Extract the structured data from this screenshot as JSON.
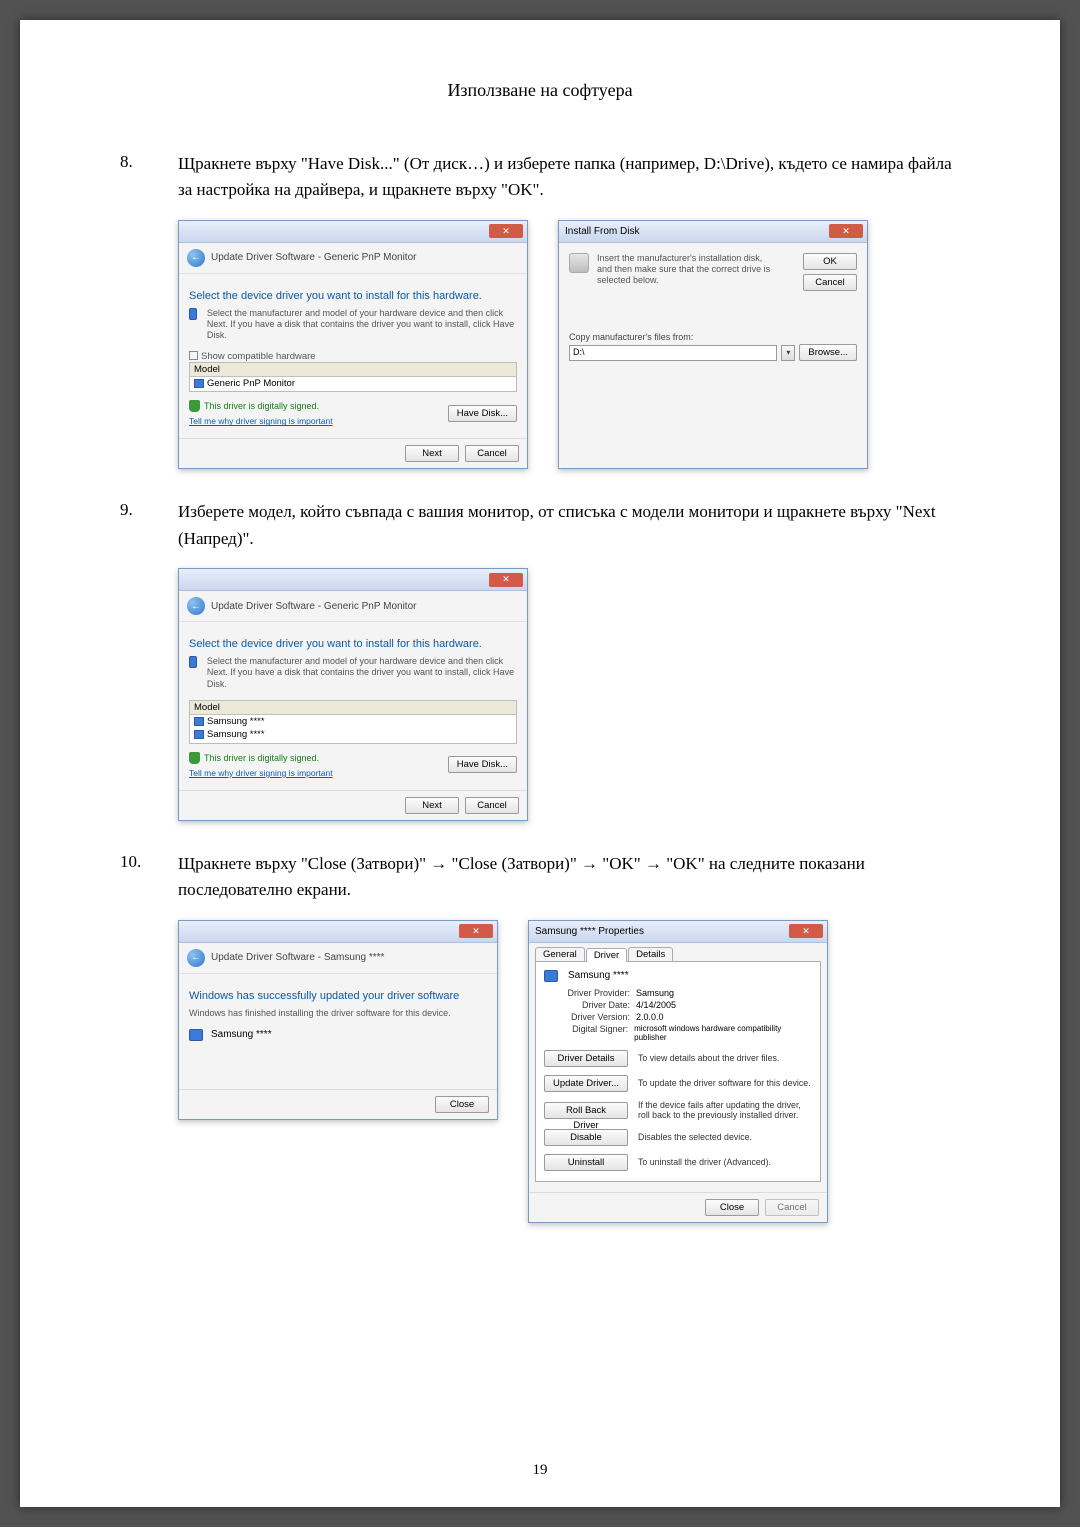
{
  "page": {
    "header": "Използване на софтуера",
    "number": "19"
  },
  "steps": {
    "s8": {
      "num": "8.",
      "text": "Щракнете върху \"Have Disk...\" (От диск…) и изберете папка (например, D:\\Drive), където се намира файла за настройка на драйвера, и щракнете върху \"OK\"."
    },
    "s9": {
      "num": "9.",
      "text": "Изберете модел, който съвпада с вашия монитор, от списъка с модели монитори и щракнете върху \"Next (Напред)\"."
    },
    "s10": {
      "num": "10.",
      "text": "Щракнете върху \"Close (Затвори)\" → \"Close (Затвори)\" → \"OK\" → \"OK\" на следните показани последователно екрани."
    }
  },
  "dlg1": {
    "crumb": "Update Driver Software - Generic PnP Monitor",
    "heading": "Select the device driver you want to install for this hardware.",
    "sub": "Select the manufacturer and model of your hardware device and then click Next. If you have a disk that contains the driver you want to install, click Have Disk.",
    "chk": "Show compatible hardware",
    "modelCap": "Model",
    "model1": "Generic PnP Monitor",
    "signed": "This driver is digitally signed.",
    "signlink": "Tell me why driver signing is important",
    "havedisk": "Have Disk...",
    "next": "Next",
    "cancel": "Cancel"
  },
  "dlg2": {
    "title": "Install From Disk",
    "msg": "Insert the manufacturer's installation disk, and then make sure that the correct drive is selected below.",
    "ok": "OK",
    "cancel": "Cancel",
    "copy": "Copy manufacturer's files from:",
    "drive": "D:\\",
    "browse": "Browse..."
  },
  "dlg3": {
    "crumb": "Update Driver Software - Generic PnP Monitor",
    "heading": "Select the device driver you want to install for this hardware.",
    "sub": "Select the manufacturer and model of your hardware device and then click Next. If you have a disk that contains the driver you want to install, click Have Disk.",
    "modelCap": "Model",
    "model1": "Samsung ****",
    "model2": "Samsung ****",
    "signed": "This driver is digitally signed.",
    "signlink": "Tell me why driver signing is important",
    "havedisk": "Have Disk...",
    "next": "Next",
    "cancel": "Cancel"
  },
  "dlg4": {
    "crumb": "Update Driver Software - Samsung ****",
    "heading": "Windows has successfully updated your driver software",
    "sub": "Windows has finished installing the driver software for this device.",
    "model": "Samsung ****",
    "close": "Close"
  },
  "dlg5": {
    "title": "Samsung **** Properties",
    "tabGeneral": "General",
    "tabDriver": "Driver",
    "tabDetails": "Details",
    "device": "Samsung ****",
    "provLabel": "Driver Provider:",
    "provVal": "Samsung",
    "dateLabel": "Driver Date:",
    "dateVal": "4/14/2005",
    "verLabel": "Driver Version:",
    "verVal": "2.0.0.0",
    "sigLabel": "Digital Signer:",
    "sigVal": "microsoft windows hardware compatibility publisher",
    "bDetails": "Driver Details",
    "bDetailsD": "To view details about the driver files.",
    "bUpdate": "Update Driver...",
    "bUpdateD": "To update the driver software for this device.",
    "bRoll": "Roll Back Driver",
    "bRollD": "If the device fails after updating the driver, roll back to the previously installed driver.",
    "bDisable": "Disable",
    "bDisableD": "Disables the selected device.",
    "bUninst": "Uninstall",
    "bUninstD": "To uninstall the driver (Advanced).",
    "close": "Close",
    "cancel": "Cancel"
  }
}
